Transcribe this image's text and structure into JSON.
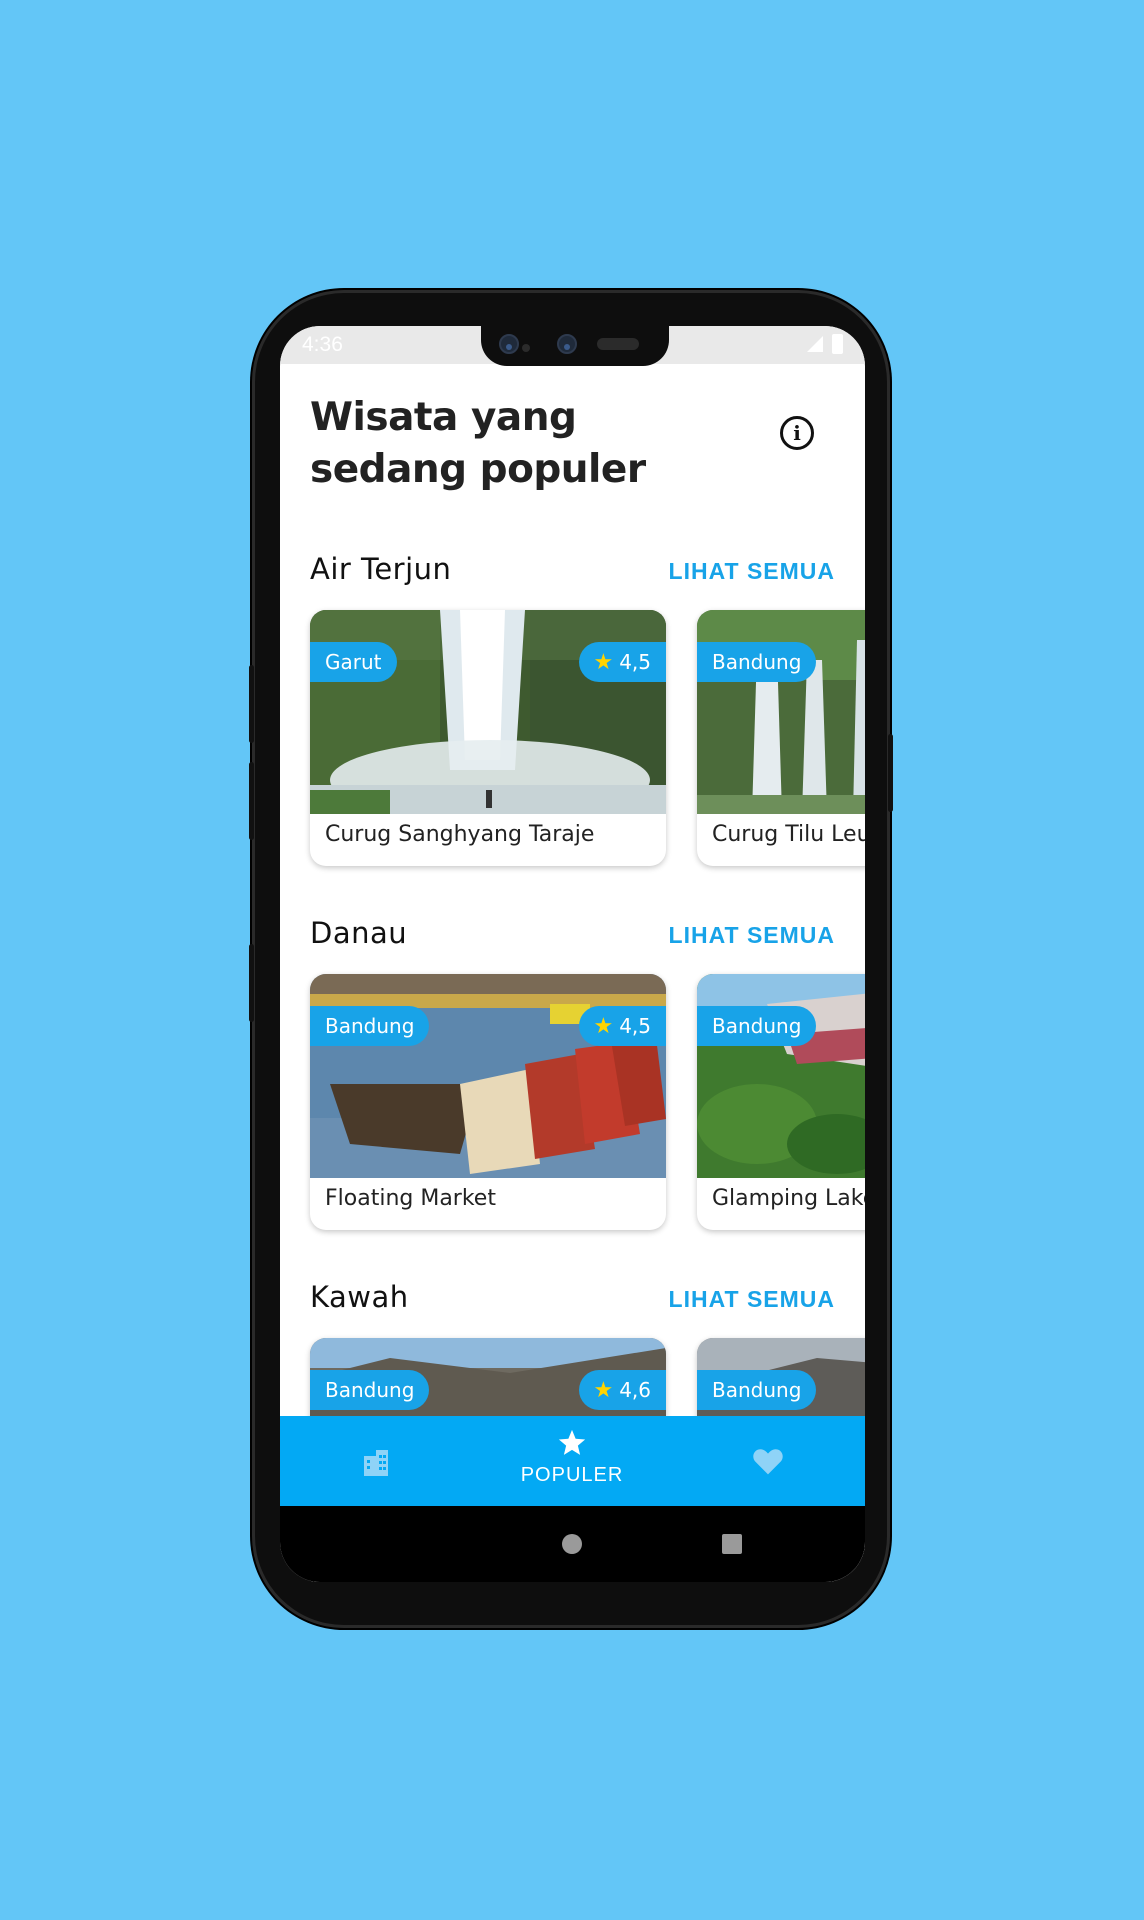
{
  "status": {
    "time": "4:36"
  },
  "header": {
    "title": "Wisata yang sedang populer",
    "info_icon": "info-circle-icon"
  },
  "sections": [
    {
      "title": "Air Terjun",
      "see_all": "LIHAT SEMUA",
      "cards": [
        {
          "name": "Curug Sanghyang Taraje",
          "location": "Garut",
          "rating": "4,5"
        },
        {
          "name": "Curug Tilu Leuwi",
          "location": "Bandung",
          "rating": ""
        }
      ]
    },
    {
      "title": "Danau",
      "see_all": "LIHAT SEMUA",
      "cards": [
        {
          "name": "Floating Market",
          "location": "Bandung",
          "rating": "4,5"
        },
        {
          "name": "Glamping Lakeside",
          "location": "Bandung",
          "rating": ""
        }
      ]
    },
    {
      "title": "Kawah",
      "see_all": "LIHAT SEMUA",
      "cards": [
        {
          "name": "",
          "location": "Bandung",
          "rating": "4,6"
        },
        {
          "name": "",
          "location": "Bandung",
          "rating": ""
        }
      ]
    }
  ],
  "bottom_nav": {
    "items": [
      {
        "icon": "city-icon",
        "label": ""
      },
      {
        "icon": "star-icon",
        "label": "POPULER"
      },
      {
        "icon": "heart-icon",
        "label": ""
      }
    ],
    "active_color": "#ffffff",
    "inactive_color": "#8fd3f7",
    "background": "#03a9f4"
  },
  "colors": {
    "accent": "#18a3e8",
    "background": "#63c6f7",
    "star": "#ffd400"
  }
}
